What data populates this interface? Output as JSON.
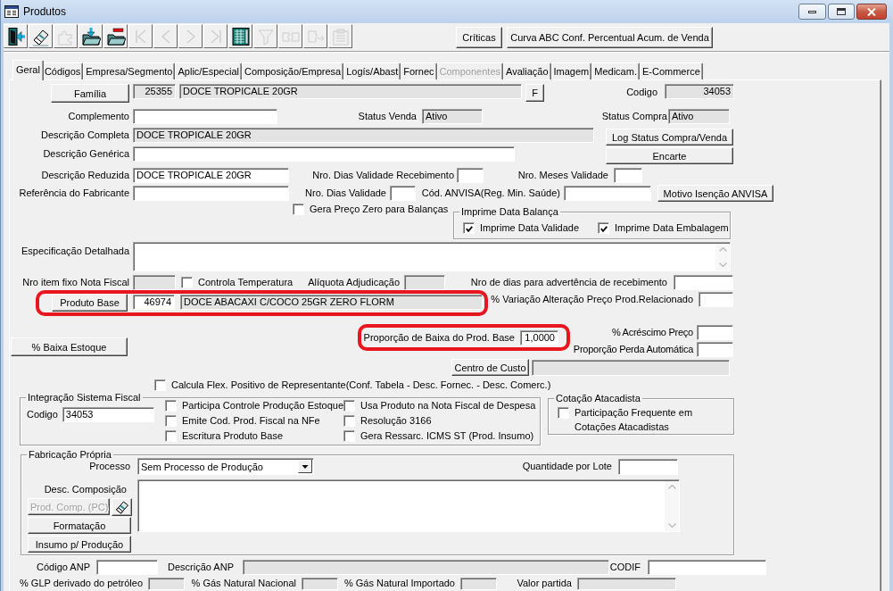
{
  "window": {
    "title": "Produtos"
  },
  "toolbar": {
    "icon_buttons": [
      {
        "disabled": false
      },
      {
        "disabled": false
      },
      {
        "disabled": true
      },
      {
        "disabled": false
      },
      {
        "disabled": false
      },
      {
        "disabled": true
      },
      {
        "disabled": true
      },
      {
        "disabled": true
      },
      {
        "disabled": true
      },
      {
        "disabled": false
      },
      {
        "disabled": true
      },
      {
        "disabled": true
      },
      {
        "disabled": true
      },
      {
        "disabled": true
      }
    ],
    "buttons": [
      "Críticas",
      "Curva ABC Conf. Percentual Acum. de Venda"
    ]
  },
  "tabs": [
    {
      "label": "Geral",
      "selected": true,
      "disabled": false
    },
    {
      "label": "Códigos",
      "selected": false,
      "disabled": false
    },
    {
      "label": "Empresa/Segmento",
      "selected": false,
      "disabled": false
    },
    {
      "label": "Aplic/Especial",
      "selected": false,
      "disabled": false
    },
    {
      "label": "Composição/Empresa",
      "selected": false,
      "disabled": false
    },
    {
      "label": "Logís/Abast",
      "selected": false,
      "disabled": false
    },
    {
      "label": "Fornec",
      "selected": false,
      "disabled": false
    },
    {
      "label": "Componentes",
      "selected": false,
      "disabled": true
    },
    {
      "label": "Avaliação",
      "selected": false,
      "disabled": false
    },
    {
      "label": "Imagem",
      "selected": false,
      "disabled": false
    },
    {
      "label": "Medicam.",
      "selected": false,
      "disabled": false
    },
    {
      "label": "E-Commerce",
      "selected": false,
      "disabled": false
    }
  ],
  "familia": {
    "button": "Família",
    "code": {
      "value": "25355",
      "disabled": true
    },
    "description": {
      "value": "DOCE TROPICALE 20GR",
      "disabled": true
    },
    "lookup_button": "F"
  },
  "codigo": {
    "label": "Codigo",
    "value": "34053",
    "disabled": true
  },
  "complemento": {
    "label": "Complemento",
    "disabled": false
  },
  "status_venda": {
    "label": "Status Venda",
    "value": "Ativo",
    "disabled": true
  },
  "status_compra": {
    "label": "Status Compra",
    "value": "Ativo",
    "disabled": true
  },
  "descricao_completa": {
    "label": "Descrição Completa",
    "value": "DOCE TROPICALE 20GR",
    "disabled": true
  },
  "log_status_button": "Log Status Compra/Venda",
  "descricao_generica": {
    "label": "Descrição Genérica",
    "disabled": false
  },
  "encarte_button": "Encarte",
  "descricao_reduzida": {
    "label": "Descrição Reduzida",
    "value": "DOCE TROPICALE 20GR",
    "disabled": false
  },
  "dias_validade_recebimento": {
    "label": "Nro. Dias Validade Recebimento",
    "disabled": false
  },
  "meses_validade": {
    "label": "Nro. Meses Validade",
    "disabled": false
  },
  "referencia_fabricante": {
    "label": "Referência do Fabricante",
    "disabled": false
  },
  "dias_validade": {
    "label": "Nro. Dias Validade",
    "disabled": false
  },
  "cod_anvisa": {
    "label": "Cód. ANVISA(Reg. Min. Saúde)",
    "disabled": false
  },
  "motivo_isencao_button": "Motivo Isenção ANVISA",
  "gera_preco_zero": {
    "label": "Gera Preço Zero para Balanças",
    "checked": false
  },
  "imprime_data_balanca": {
    "title": "Imprime Data Balança",
    "options": [
      {
        "label": "Imprime Data Validade",
        "checked": true
      },
      {
        "label": "Imprime Data Embalagem",
        "checked": true
      }
    ]
  },
  "especificacao_detalhada": {
    "label": "Especificação Detalhada",
    "disabled": false
  },
  "nro_item_fixo": {
    "label": "Nro item fixo Nota Fiscal",
    "disabled": true
  },
  "controla_temperatura": {
    "label": "Controla Temperatura",
    "checked": false
  },
  "aliquota_adjudicacao": {
    "label": "Alíquota Adjudicação",
    "disabled": true
  },
  "dias_advertencia": {
    "label": "Nro de dias para advertência de recebimento",
    "disabled": false
  },
  "produto_base": {
    "button": "Produto Base",
    "code": {
      "value": "46974",
      "disabled": false
    },
    "description": {
      "value": "DOCE ABACAXI C/COCO 25GR ZERO FLORM",
      "disabled": true
    },
    "highlighted": true
  },
  "variacao_preco": {
    "label": "% Variação Alteração Preço Prod.Relacionado",
    "disabled": false
  },
  "baixa_estoque_button": "% Baixa Estoque",
  "proporcao_baixa": {
    "label": "Proporção de Baixa do Prod. Base",
    "value": "1,0000",
    "disabled": false,
    "highlighted": true
  },
  "acrescimo_preco": {
    "label": "% Acréscimo Preço",
    "disabled": false
  },
  "proporcao_perda": {
    "label": "Proporção Perda Automática",
    "disabled": false
  },
  "centro_custo": {
    "button": "Centro de Custo",
    "field": {
      "disabled": true
    }
  },
  "calcula_flex": {
    "label": "Calcula Flex. Positivo de Representante(Conf. Tabela - Desc. Fornec. - Desc. Comerc.)",
    "checked": false
  },
  "integracao_fiscal": {
    "title": "Integração Sistema Fiscal",
    "codigo": {
      "label": "Codigo",
      "value": "34053",
      "disabled": false
    },
    "options": [
      {
        "label": "Participa Controle Produção Estoque",
        "checked": false
      },
      {
        "label": "Emite Cod. Prod. Fiscal na NFe",
        "checked": false
      },
      {
        "label": "Escritura Produto Base",
        "checked": false
      },
      {
        "label": "Usa Produto na Nota Fiscal de Despesa",
        "checked": false
      },
      {
        "label": "Resolução 3166",
        "checked": false
      },
      {
        "label": "Gera Ressarc. ICMS ST (Prod. Insumo)",
        "checked": false
      }
    ]
  },
  "cotacao_atacadista": {
    "title": "Cotação Atacadista",
    "options": [
      {
        "label": "Participação Frequente em Cotações Atacadistas",
        "checked": false
      }
    ]
  },
  "fabricacao_propria": {
    "title": "Fabricação Própria",
    "processo": {
      "label": "Processo",
      "value": "Sem Processo de Produção"
    },
    "quantidade_lote": {
      "label": "Quantidade por Lote",
      "disabled": false
    },
    "desc_composicao": {
      "label": "Desc. Composição",
      "disabled": false
    },
    "buttons": [
      {
        "label": "Prod. Comp. (PC)",
        "disabled": true
      },
      {
        "label": "Formatação",
        "disabled": false
      },
      {
        "label": "Insumo p/ Produção",
        "disabled": false
      }
    ]
  },
  "codigo_anp": {
    "label": "Código ANP",
    "disabled": false
  },
  "descricao_anp": {
    "label": "Descrição ANP",
    "disabled": true
  },
  "codif": {
    "label": "CODIF",
    "disabled": false
  },
  "combustiveis": [
    {
      "label": "% GLP derivado do petróleo",
      "disabled": true
    },
    {
      "label": "% Gás Natural Nacional",
      "disabled": true
    },
    {
      "label": "% Gás Natural Importado",
      "disabled": true
    },
    {
      "label": "Valor partida",
      "disabled": true
    }
  ]
}
